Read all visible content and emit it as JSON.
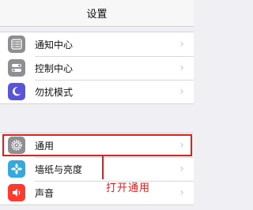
{
  "nav": {
    "title": "设置"
  },
  "groups": [
    {
      "items": [
        {
          "label": "通知中心",
          "icon": "notification-center-icon",
          "color": "#8e8e93"
        },
        {
          "label": "控制中心",
          "icon": "control-center-icon",
          "color": "#8e8e93"
        },
        {
          "label": "勿扰模式",
          "icon": "moon-icon",
          "color": "#5856d6"
        }
      ]
    },
    {
      "items": [
        {
          "label": "通用",
          "icon": "gear-icon",
          "color": "#8e8e93"
        },
        {
          "label": "墙纸与亮度",
          "icon": "wallpaper-icon",
          "color": "#34aadc"
        },
        {
          "label": "声音",
          "icon": "sound-icon",
          "color": "#ff3b30"
        }
      ]
    }
  ],
  "annotation": {
    "text": "打开通用",
    "color": "#e02020"
  }
}
